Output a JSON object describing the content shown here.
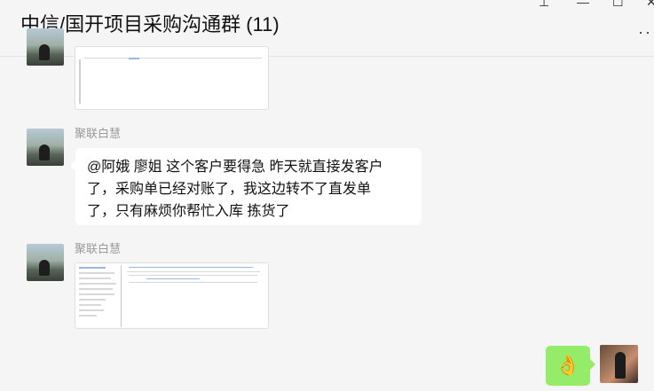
{
  "window": {
    "title": "中信/国开项目采购沟通群 (11)",
    "pin_icon": "pin-icon",
    "minimize_icon": "minimize-icon",
    "maximize_icon": "maximize-icon",
    "close_icon": "close-icon",
    "more_icon": "more-icon",
    "more_glyph": "··"
  },
  "messages": [
    {
      "sender": "",
      "type": "image"
    },
    {
      "sender": "聚联白慧",
      "type": "text",
      "lines": [
        "@阿娥 廖姐 这个客户要得急 昨天就直接发客户",
        "了，采购单已经对账了，我这边转不了直发单",
        "了，只有麻烦你帮忙入库 拣货了"
      ]
    },
    {
      "sender": "聚联白慧",
      "type": "image"
    },
    {
      "sender": "",
      "type": "emoji",
      "emoji": "👌",
      "self": true
    }
  ],
  "colors": {
    "background": "#f5f5f5",
    "bubble_other": "#ffffff",
    "bubble_self": "#95ec69",
    "sender_name": "#9a9a9a"
  }
}
